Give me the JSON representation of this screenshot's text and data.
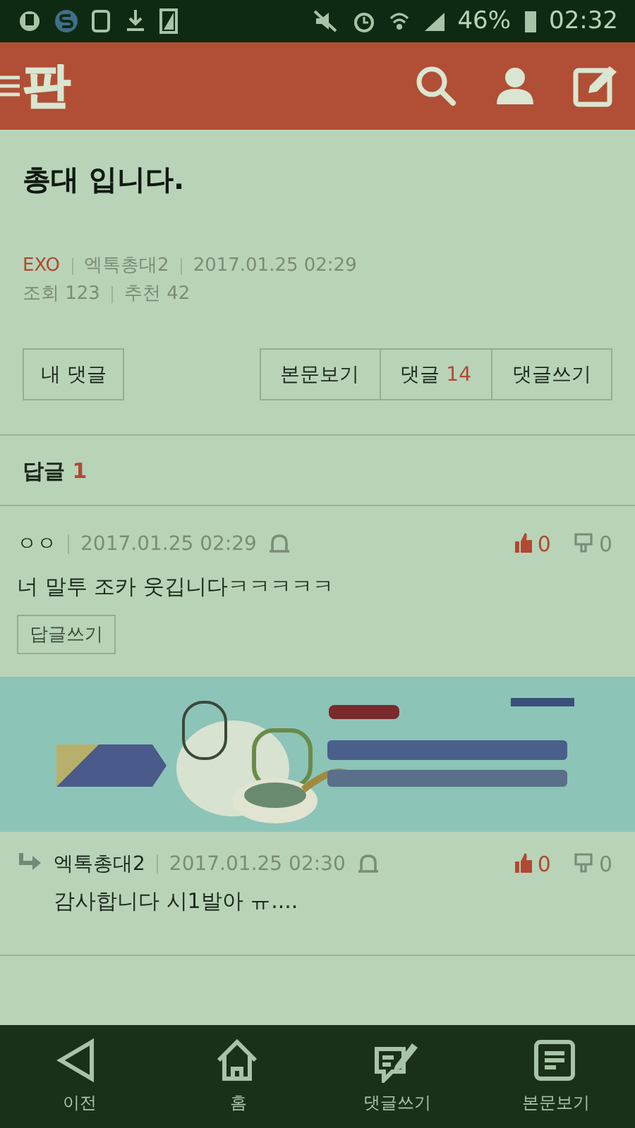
{
  "status_bar": {
    "battery": "46%",
    "time": "02:32"
  },
  "header": {
    "logo": "판"
  },
  "post": {
    "title": "총대 입니다.",
    "category": "EXO",
    "author": "엑톡총대2",
    "date": "2017.01.25 02:29",
    "views": "조회 123",
    "recommends": "추천 42"
  },
  "actions": {
    "my_comments": "내 댓글",
    "view_post": "본문보기",
    "comments_label": "댓글",
    "comments_count": "14",
    "write_comment": "댓글쓰기"
  },
  "replies_heading": {
    "label": "답글",
    "count": "1"
  },
  "comments": [
    {
      "kind": "comment",
      "author": "ㅇㅇ",
      "date": "2017.01.25 02:29",
      "text": "너 말투 조카 웃깁니다ㅋㅋㅋㅋㅋ",
      "likes": "0",
      "dislikes": "0",
      "reply_button": "답글쓰기"
    },
    {
      "kind": "reply",
      "author": "엑톡총대2",
      "date": "2017.01.25 02:30",
      "text": "감사합니다 시1발아 ㅠ....",
      "likes": "0",
      "dislikes": "0"
    }
  ],
  "bottom_nav": [
    {
      "kind": "back",
      "label": "이전"
    },
    {
      "kind": "home",
      "label": "홈"
    },
    {
      "kind": "write",
      "label": "댓글쓰기"
    },
    {
      "kind": "document",
      "label": "본문보기"
    }
  ]
}
